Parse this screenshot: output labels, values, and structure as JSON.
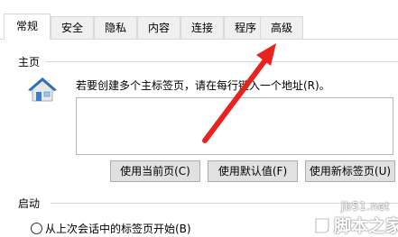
{
  "tabs": [
    {
      "label": "常规",
      "active": true
    },
    {
      "label": "安全",
      "active": false
    },
    {
      "label": "隐私",
      "active": false
    },
    {
      "label": "内容",
      "active": false
    },
    {
      "label": "连接",
      "active": false
    },
    {
      "label": "程序",
      "active": false
    },
    {
      "label": "高级",
      "active": false
    }
  ],
  "homepage": {
    "section_title": "主页",
    "hint": "若要创建多个主标签页，请在每行键入一个地址(R)。",
    "textarea_value": "",
    "buttons": {
      "use_current": "使用当前页(C)",
      "use_default": "使用默认值(F)",
      "use_new_tab": "使用新标签页(U)"
    }
  },
  "startup": {
    "section_title": "启动",
    "radio_option": "从上次会话中的标签页开始(B)",
    "radio_checked": false
  },
  "annotation": {
    "arrow_color": "#e8231f"
  },
  "watermark": {
    "domain": "jb51.net",
    "name": "脚本之家"
  },
  "colors": {
    "tab_border": "#d9d9d9",
    "button_bg": "#e1e1e1",
    "house_roof": "#2f6fb8",
    "house_wall": "#e8e8e8"
  }
}
